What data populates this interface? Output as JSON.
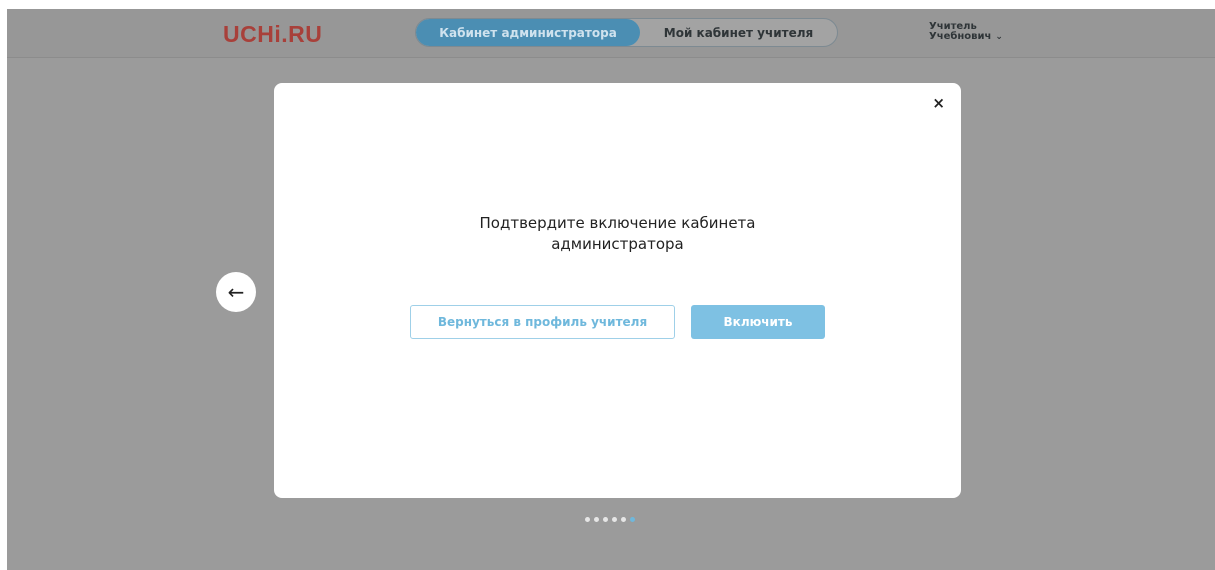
{
  "header": {
    "logo": "UCHi.RU",
    "tabs": [
      {
        "label": "Кабинет администратора",
        "active": true
      },
      {
        "label": "Мой кабинет учителя",
        "active": false
      }
    ],
    "user": {
      "line1": "Учитель",
      "line2": "Учебнович"
    }
  },
  "modal": {
    "title": "Подтвердите включение кабинета администратора",
    "secondary_button": "Вернуться в профиль учителя",
    "primary_button": "Включить",
    "close_glyph": "×"
  },
  "carousel": {
    "back_glyph": "←",
    "dots_total": 6,
    "active_dot": 6
  },
  "colors": {
    "logo": "#a8403a",
    "active_tab": "#4b8eb3",
    "accent": "#7ec1e3",
    "overlay": "#9b9b9b"
  }
}
